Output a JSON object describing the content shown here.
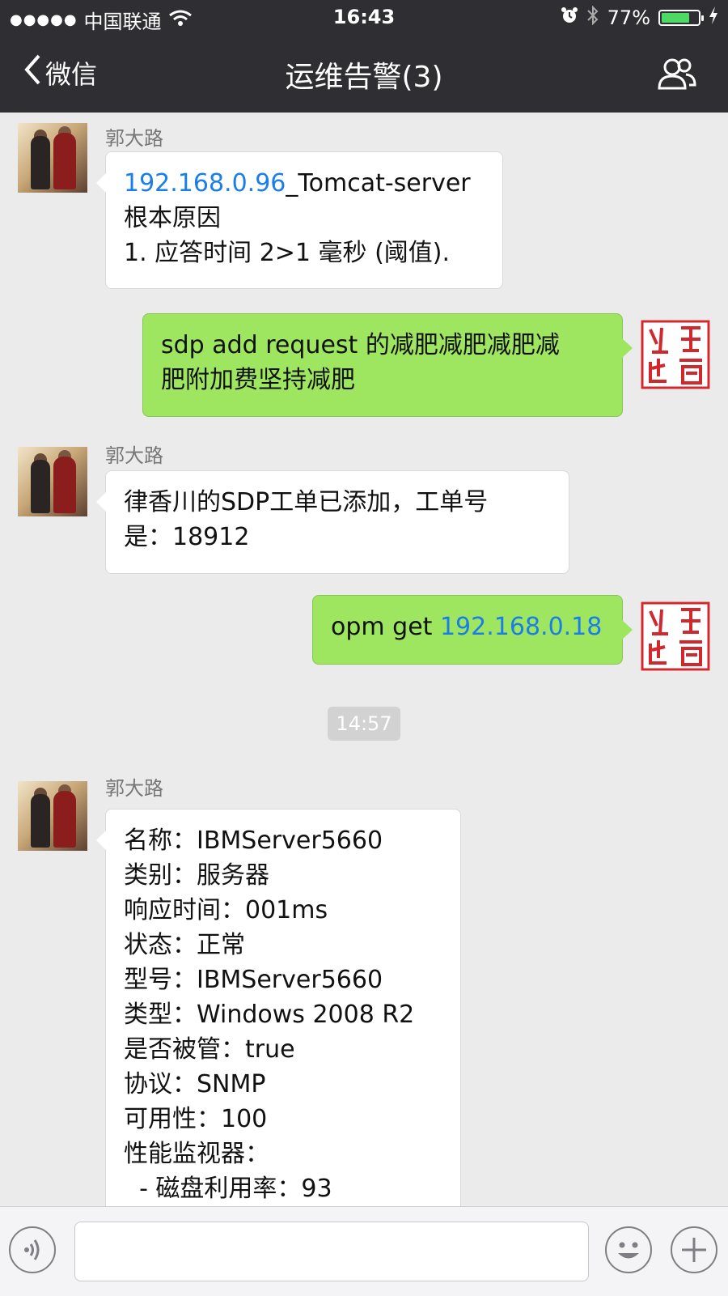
{
  "status_bar": {
    "signal": "●●●●●",
    "carrier": "中国联通",
    "time": "16:43",
    "battery_percent": "77%",
    "battery_level": 0.77
  },
  "nav": {
    "back_label": "微信",
    "title": "运维告警(3)"
  },
  "messages": [
    {
      "sender": "郭大路",
      "link": "192.168.0.96",
      "lines": [
        "_Tomcat-server",
        "根本原因",
        "1. 应答时间 2>1 毫秒 (阈值)."
      ]
    },
    {
      "lines": [
        "sdp add request 的减肥减肥减肥减",
        "肥附加费坚持减肥"
      ]
    },
    {
      "sender": "郭大路",
      "lines": [
        "律香川的SDP工单已添加，工单号",
        "是：18912"
      ]
    },
    {
      "prefix": "opm get ",
      "link": "192.168.0.18"
    },
    {
      "sender": "郭大路",
      "lines": [
        "名称：IBMServer5660",
        "类别：服务器",
        "响应时间：001ms",
        "状态：正常",
        "型号：IBMServer5660",
        "类型：Windows 2008 R2",
        "是否被管：true",
        "协议：SNMP",
        "可用性：100",
        "性能监视器：",
        "  - 磁盘利用率：93"
      ]
    }
  ],
  "time_separator": "14:57",
  "colors": {
    "bar_bg": "#2e2e33",
    "chat_bg": "#ebebeb",
    "outgoing_bubble": "#9ee560",
    "link": "#1a7ee8",
    "seal_red": "#d0282d"
  },
  "icons": {
    "wifi": "wifi-icon",
    "alarm": "alarm-icon",
    "bluetooth": "bluetooth-icon",
    "charging": "bolt-icon",
    "back": "chevron-left-icon",
    "group": "people-icon",
    "voice": "voice-icon",
    "emoji": "emoji-icon",
    "more": "plus-icon"
  }
}
